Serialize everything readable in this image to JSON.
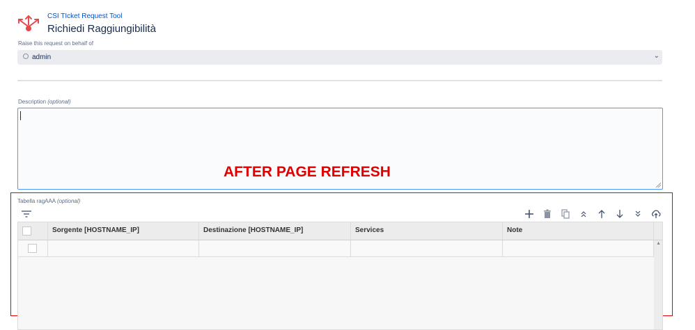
{
  "header": {
    "tool_name": "CSI TIcket Request Tool",
    "page_title": "Richiedi Raggiungibilità"
  },
  "behalf": {
    "label": "Raise this request on behalf of",
    "value": "admin"
  },
  "description": {
    "label": "Description",
    "optional": "(optional)"
  },
  "annotation": "AFTER PAGE REFRESH",
  "table": {
    "label": "Tabella ragAAA",
    "optional": "(optional)",
    "columns": [
      "Sorgente [HOSTNAME_IP]",
      "Destinazione [HOSTNAME_IP]",
      "Services",
      "Note"
    ]
  },
  "toolbar": [
    "add-icon",
    "delete-icon",
    "copy-icon",
    "move-top-icon",
    "move-up-icon",
    "move-down-icon",
    "move-bottom-icon",
    "upload-cloud-icon"
  ],
  "colors": {
    "accent": "#0052cc",
    "annotation": "#e00000",
    "logo": "#e5484d"
  }
}
